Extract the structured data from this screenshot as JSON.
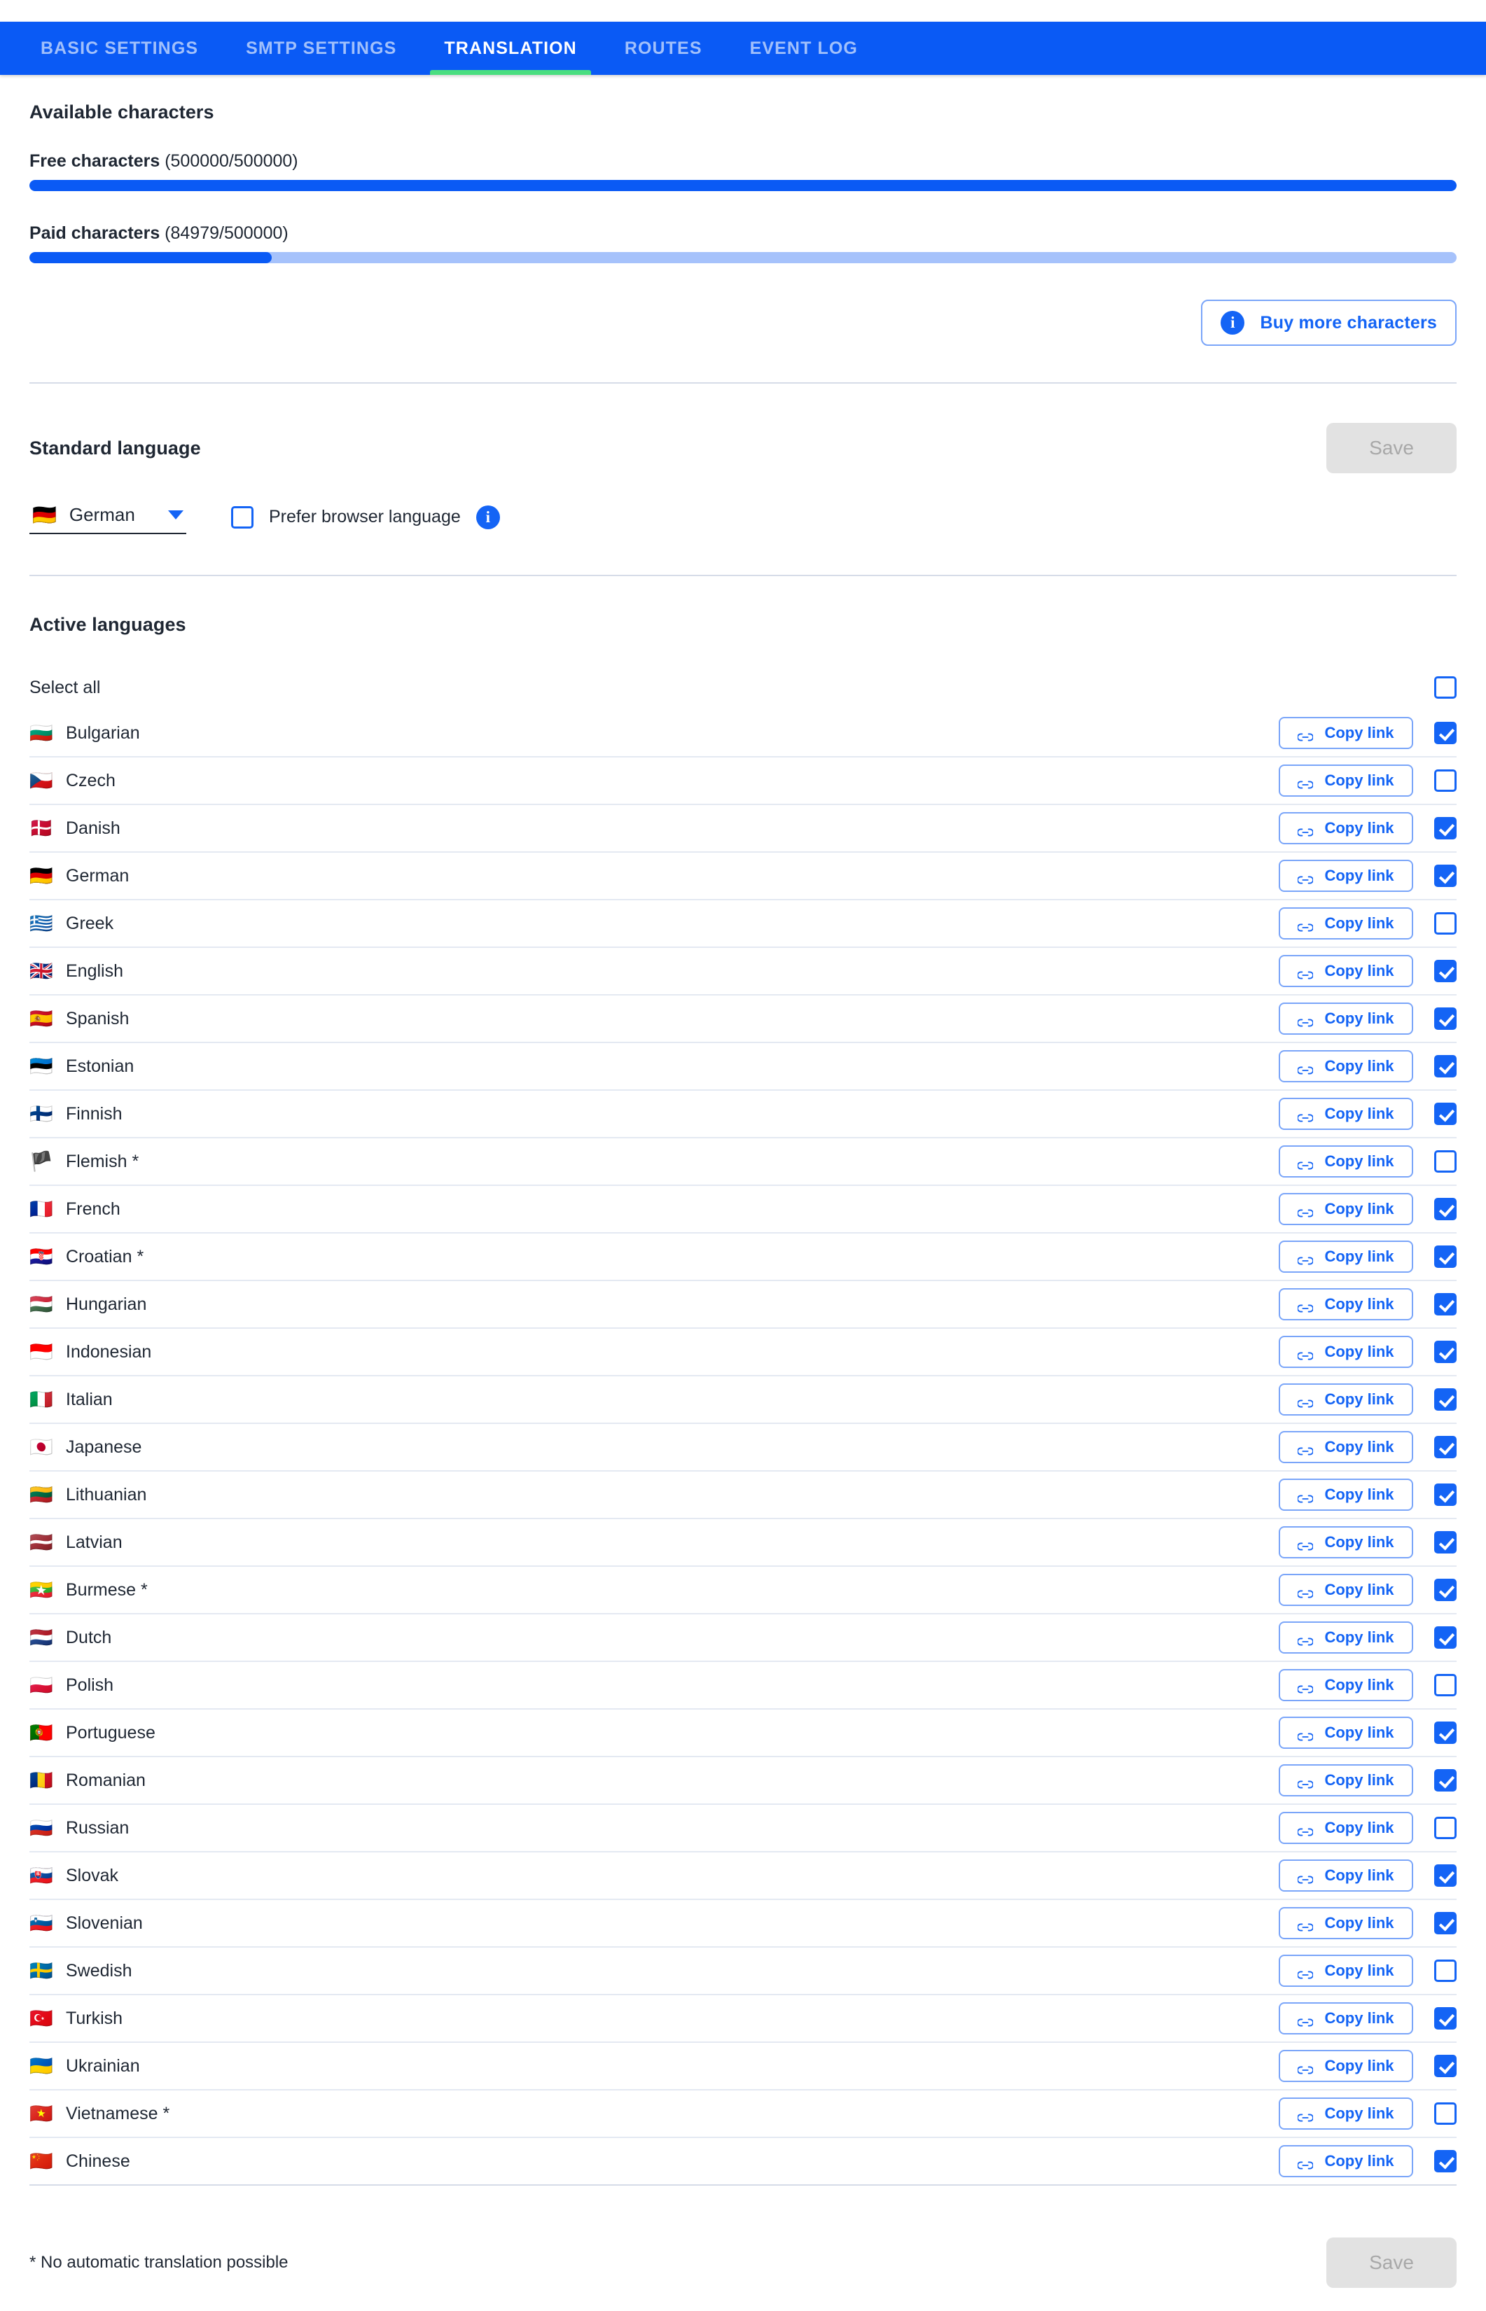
{
  "tabs": [
    {
      "label": "BASIC SETTINGS",
      "active": false
    },
    {
      "label": "SMTP SETTINGS",
      "active": false
    },
    {
      "label": "TRANSLATION",
      "active": true
    },
    {
      "label": "ROUTES",
      "active": false
    },
    {
      "label": "EVENT LOG",
      "active": false
    }
  ],
  "colors": {
    "brand_blue": "#0a5af5",
    "link_blue": "#1464f5",
    "active_tab_underline": "#4ade80",
    "progress_track": "#a6c2fb",
    "divider": "#d6dce8",
    "disabled_button_bg": "#e2e2e2",
    "disabled_button_text": "#a8a8a8"
  },
  "available": {
    "heading": "Available characters",
    "free": {
      "label": "Free characters",
      "quantity": "(500000/500000)",
      "used": 500000,
      "total": 500000,
      "percent": 100
    },
    "paid": {
      "label": "Paid characters",
      "quantity": "(84979/500000)",
      "used": 84979,
      "total": 500000,
      "percent": 17
    },
    "buy_button": "Buy more characters",
    "buy_icon": "info-icon"
  },
  "standard_language": {
    "heading": "Standard language",
    "save_label": "Save",
    "save_disabled": true,
    "selected_flag": "🇩🇪",
    "selected_value": "German",
    "prefer_browser_label": "Prefer browser language",
    "prefer_browser_checked": false,
    "info_icon": "info-icon"
  },
  "active_languages": {
    "heading": "Active languages",
    "select_all_label": "Select all",
    "select_all_checked": false,
    "copy_link_label": "Copy link",
    "copy_link_icon": "link-icon",
    "footnote": "* No automatic translation possible",
    "save_label": "Save",
    "save_disabled": true,
    "rows": [
      {
        "flag": "🇧🇬",
        "name": "Bulgarian",
        "checked": true
      },
      {
        "flag": "🇨🇿",
        "name": "Czech",
        "checked": false
      },
      {
        "flag": "🇩🇰",
        "name": "Danish",
        "checked": true
      },
      {
        "flag": "🇩🇪",
        "name": "German",
        "checked": true
      },
      {
        "flag": "🇬🇷",
        "name": "Greek",
        "checked": false
      },
      {
        "flag": "🇬🇧",
        "name": "English",
        "checked": true
      },
      {
        "flag": "🇪🇸",
        "name": "Spanish",
        "checked": true
      },
      {
        "flag": "🇪🇪",
        "name": "Estonian",
        "checked": true
      },
      {
        "flag": "🇫🇮",
        "name": "Finnish",
        "checked": true
      },
      {
        "flag": "🏴",
        "name": "Flemish *",
        "checked": false
      },
      {
        "flag": "🇫🇷",
        "name": "French",
        "checked": true
      },
      {
        "flag": "🇭🇷",
        "name": "Croatian *",
        "checked": true
      },
      {
        "flag": "🇭🇺",
        "name": "Hungarian",
        "checked": true
      },
      {
        "flag": "🇮🇩",
        "name": "Indonesian",
        "checked": true
      },
      {
        "flag": "🇮🇹",
        "name": "Italian",
        "checked": true
      },
      {
        "flag": "🇯🇵",
        "name": "Japanese",
        "checked": true
      },
      {
        "flag": "🇱🇹",
        "name": "Lithuanian",
        "checked": true
      },
      {
        "flag": "🇱🇻",
        "name": "Latvian",
        "checked": true
      },
      {
        "flag": "🇲🇲",
        "name": "Burmese *",
        "checked": true
      },
      {
        "flag": "🇳🇱",
        "name": "Dutch",
        "checked": true
      },
      {
        "flag": "🇵🇱",
        "name": "Polish",
        "checked": false
      },
      {
        "flag": "🇵🇹",
        "name": "Portuguese",
        "checked": true
      },
      {
        "flag": "🇷🇴",
        "name": "Romanian",
        "checked": true
      },
      {
        "flag": "🇷🇺",
        "name": "Russian",
        "checked": false
      },
      {
        "flag": "🇸🇰",
        "name": "Slovak",
        "checked": true
      },
      {
        "flag": "🇸🇮",
        "name": "Slovenian",
        "checked": true
      },
      {
        "flag": "🇸🇪",
        "name": "Swedish",
        "checked": false
      },
      {
        "flag": "🇹🇷",
        "name": "Turkish",
        "checked": true
      },
      {
        "flag": "🇺🇦",
        "name": "Ukrainian",
        "checked": true
      },
      {
        "flag": "🇻🇳",
        "name": "Vietnamese *",
        "checked": false
      },
      {
        "flag": "🇨🇳",
        "name": "Chinese",
        "checked": true
      }
    ]
  }
}
